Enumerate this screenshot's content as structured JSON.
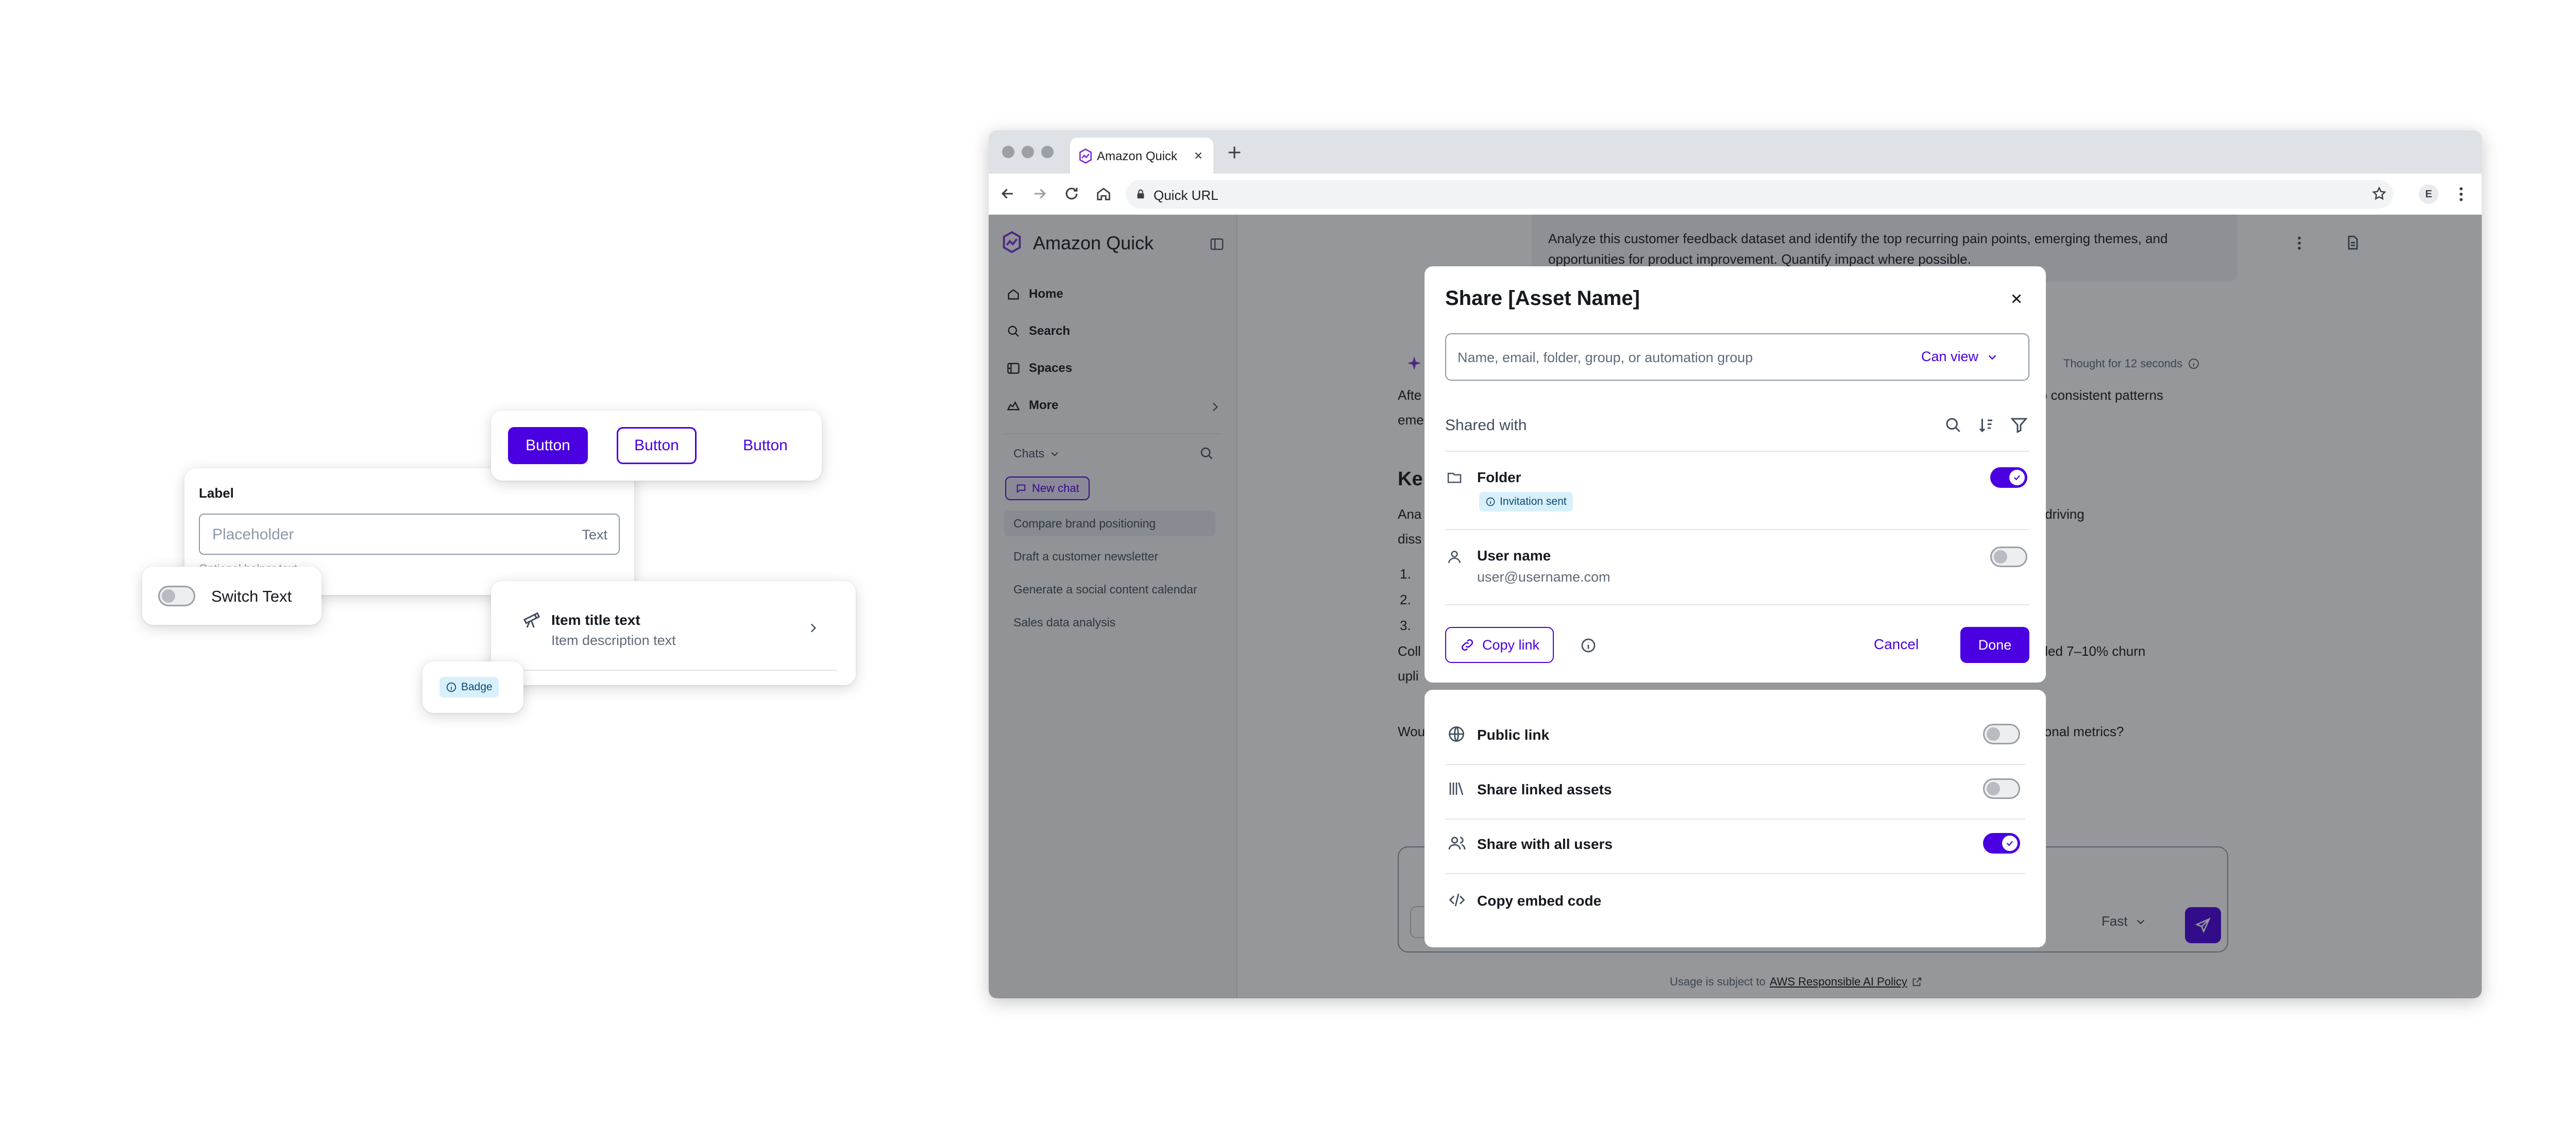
{
  "components": {
    "buttons": {
      "primary": "Button",
      "outline": "Button",
      "link": "Button"
    },
    "input": {
      "label": "Label",
      "placeholder": "Placeholder",
      "suffix": "Text",
      "helper": "Optional helper text"
    },
    "switch": {
      "label": "Switch Text"
    },
    "list_item": {
      "title": "Item title text",
      "description": "Item description text"
    },
    "badge": {
      "label": "Badge"
    }
  },
  "browser": {
    "tab_title": "Amazon Quick",
    "address": "Quick URL",
    "profile_initial": "E"
  },
  "app": {
    "name": "Amazon Quick",
    "nav": [
      {
        "label": "Home",
        "icon": "home-icon"
      },
      {
        "label": "Search",
        "icon": "search-icon"
      },
      {
        "label": "Spaces",
        "icon": "spaces-icon"
      },
      {
        "label": "More",
        "icon": "more-icon"
      }
    ],
    "chats_label": "Chats",
    "new_chat": "New chat",
    "chats": [
      "Compare brand positioning",
      "Draft a customer newsletter",
      "Generate a social content calendar",
      "Sales data analysis"
    ],
    "prompt_text": "Analyze this customer feedback dataset and identify the top recurring pain points, emerging themes, and opportunities for product improvement. Quantify impact where possible.",
    "thought_label": "Thought for 12 seconds",
    "response_fragments": {
      "line1_start": "Afte",
      "line1_end": "o consistent patterns",
      "line2_start": "eme",
      "heading_start": "Ke",
      "para_start": "Ana",
      "para_end": "s driving",
      "para2_start": "diss",
      "list": [
        "1. ",
        "2. ",
        "3. "
      ],
      "collab_start": "Coll",
      "collab_end": "leled 7–10% churn",
      "collab2": "upli",
      "q_start": "Wou",
      "q_end": "itional metrics?"
    },
    "model_label": "Fast",
    "footer_prefix": "Usage is subject to",
    "footer_link": "AWS Responsible AI Policy"
  },
  "share_dialog": {
    "title": "Share [Asset Name]",
    "input_placeholder": "Name, email, folder, group, or automation group",
    "permission": "Can view",
    "shared_with_label": "Shared with",
    "entries": [
      {
        "name": "Folder",
        "badge": "Invitation sent",
        "enabled": true
      },
      {
        "name": "User name",
        "email": "user@username.com",
        "enabled": false
      }
    ],
    "copy_link": "Copy link",
    "cancel": "Cancel",
    "done": "Done"
  },
  "share_options": [
    {
      "label": "Public link",
      "icon": "globe-icon",
      "enabled": false
    },
    {
      "label": "Share linked assets",
      "icon": "library-icon",
      "enabled": false
    },
    {
      "label": "Share with all users",
      "icon": "users-icon",
      "enabled": true
    },
    {
      "label": "Copy embed code",
      "icon": "code-icon"
    }
  ],
  "colors": {
    "accent": "#4a00e0",
    "badge_bg": "#d8f0fb",
    "badge_text": "#0a4a74"
  }
}
